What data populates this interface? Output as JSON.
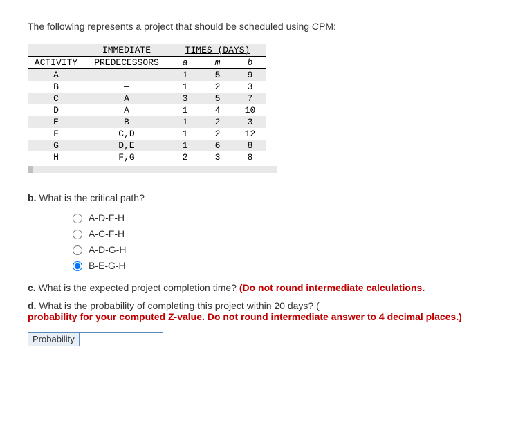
{
  "intro": "The following represents a project that should be scheduled using CPM:",
  "table": {
    "header1": {
      "immediate": "IMMEDIATE",
      "times": "TIMES (DAYS)"
    },
    "header2": {
      "activity": "ACTIVITY",
      "predecessors": "PREDECESSORS",
      "a": "a",
      "m": "m",
      "b": "b"
    },
    "rows": [
      {
        "activity": "A",
        "pred": "—",
        "a": "1",
        "m": "5",
        "b": "9"
      },
      {
        "activity": "B",
        "pred": "—",
        "a": "1",
        "m": "2",
        "b": "3"
      },
      {
        "activity": "C",
        "pred": "A",
        "a": "3",
        "m": "5",
        "b": "7"
      },
      {
        "activity": "D",
        "pred": "A",
        "a": "1",
        "m": "4",
        "b": "10"
      },
      {
        "activity": "E",
        "pred": "B",
        "a": "1",
        "m": "2",
        "b": "3"
      },
      {
        "activity": "F",
        "pred": "C,D",
        "a": "1",
        "m": "2",
        "b": "12"
      },
      {
        "activity": "G",
        "pred": "D,E",
        "a": "1",
        "m": "6",
        "b": "8"
      },
      {
        "activity": "H",
        "pred": "F,G",
        "a": "2",
        "m": "3",
        "b": "8"
      }
    ]
  },
  "partB": {
    "prefix": "b.",
    "text": " What is the critical path?",
    "options": [
      {
        "label": "A-D-F-H",
        "selected": false
      },
      {
        "label": "A-C-F-H",
        "selected": false
      },
      {
        "label": "A-D-G-H",
        "selected": false
      },
      {
        "label": "B-E-G-H",
        "selected": true
      }
    ]
  },
  "partC": {
    "prefix": "c.",
    "text": " What is the expected project completion time? ",
    "red": "(Do not round intermediate calculations."
  },
  "partD": {
    "prefix": "d.",
    "text": " What is the probability of completing this project within 20 days? ",
    "marker": "(",
    "red": "probability for your computed Z-value. Do not round intermediate answer to 4 decimal places.)"
  },
  "answer": {
    "label": "Probability",
    "value": ""
  }
}
